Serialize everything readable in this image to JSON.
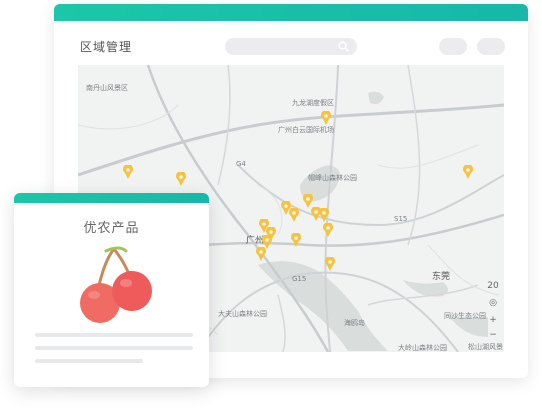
{
  "panel": {
    "title": "区域管理",
    "accent": "#1cc6a8"
  },
  "toolbar": {
    "search_icon": "search-icon"
  },
  "map": {
    "labels": {
      "nanshan": "南丹山风景区",
      "jiulong": "九龙湖度假区",
      "airport": "广州白云国际机场",
      "maofeng": "帽峰山森林公园",
      "guangzhou": "广州",
      "dongguan": "东莞",
      "dafu": "大夫山森林公园",
      "haiou": "海鸥岛",
      "tongsha": "同沙生态公园",
      "dalingshan": "大岭山森林公园",
      "songshan": "松山湖风景",
      "road_g4": "G4",
      "road_s15": "S15",
      "road_g15": "G15"
    },
    "zoom": {
      "level": "20",
      "locate": "◎",
      "plus": "+",
      "minus": "−"
    },
    "pin_color": "#f5c242"
  },
  "card": {
    "title": "优农产品",
    "cherry_color": "#ef5a5a"
  }
}
